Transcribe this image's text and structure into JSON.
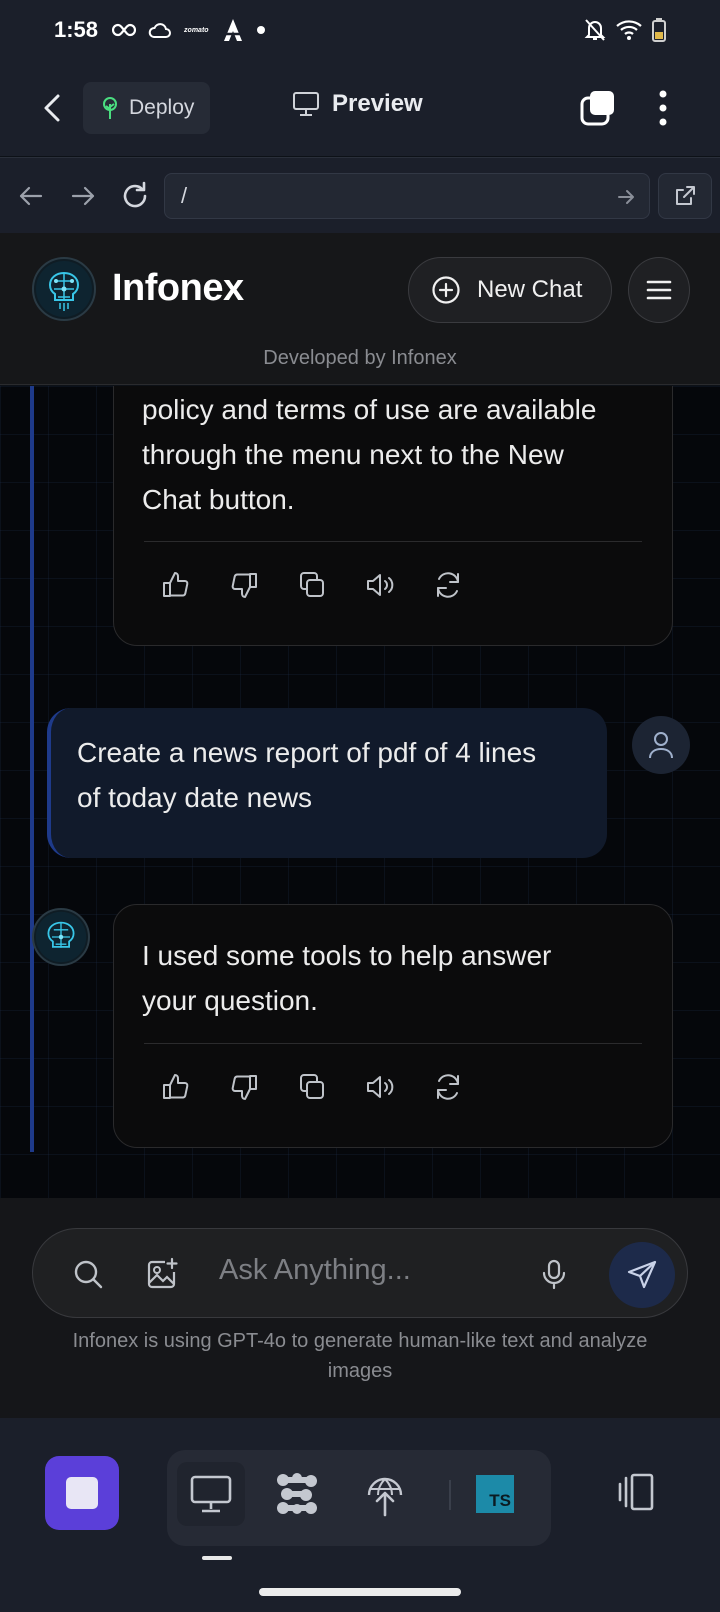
{
  "status": {
    "time": "1:58",
    "zomato": "zomato"
  },
  "appbar": {
    "deploy_label": "Deploy",
    "preview_label": "Preview"
  },
  "urlbar": {
    "url": "/"
  },
  "site": {
    "brand": "Infonex",
    "new_chat_label": "New Chat",
    "subtitle": "Developed by Infonex"
  },
  "messages": {
    "ai_1_lines": [
      "policy and terms of use are available",
      "through the menu next to the New",
      "Chat button."
    ],
    "user_1_lines": [
      "Create a news report of pdf of 4 lines",
      "of today date news"
    ],
    "ai_2_lines": [
      "I used some tools to help answer",
      "your question."
    ]
  },
  "composer": {
    "placeholder": "Ask Anything...",
    "disclaimer_lines": [
      "Infonex is using GPT-4o to generate human-like text and analyze",
      "images"
    ]
  },
  "toolbar": {
    "ts_label": "TS"
  },
  "colors": {
    "accent_purple": "#5b3fd9",
    "thread_blue": "#1e3a8a",
    "deploy_green": "#4ade80",
    "ts_teal": "#1c8aa8"
  }
}
